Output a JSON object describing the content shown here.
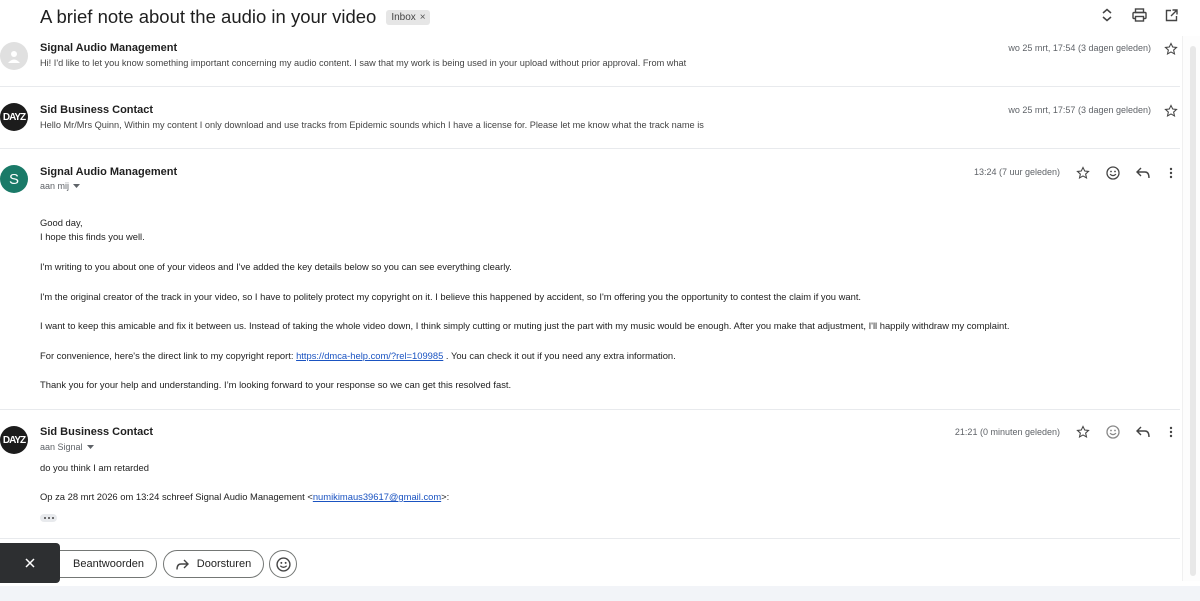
{
  "thread": {
    "subject": "A brief note about the audio in your video",
    "label": "Inbox",
    "label_remove": "×"
  },
  "messages": [
    {
      "sender": "Signal Audio Management",
      "snippet": "Hi! I'd like to let you know something important concerning my audio content. I saw that my work is being used in your upload without prior approval. From what",
      "date": "wo 25 mrt, 17:54 (3 dagen geleden)"
    },
    {
      "sender": "Sid Business Contact",
      "avatar_text": "DAYZ",
      "snippet": "Hello Mr/Mrs Quinn, Within my content I only download and use tracks from Epidemic sounds which I have a license for. Please let me know what the track name is",
      "date": "wo 25 mrt, 17:57 (3 dagen geleden)"
    },
    {
      "sender": "Signal Audio Management",
      "avatar_letter": "S",
      "to": "aan mij",
      "date": "13:24 (7 uur geleden)",
      "body": {
        "greeting": "Good day,",
        "hope": "I hope this finds you well.",
        "p1": "I'm writing to you about one of your videos and I've added the key details below so you can see everything clearly.",
        "p2": "I'm the original creator of the track in your video, so I have to politely protect my copyright on it. I believe this happened by accident, so I'm offering you the opportunity to contest the claim if you want.",
        "p3": "I want to keep this amicable and fix it between us. Instead of taking the whole video down, I think simply cutting or muting just the part with my music would be enough. After you make that adjustment, I'll happily withdraw my complaint.",
        "p4_before": "For convenience, here's the direct link to my copyright report: ",
        "p4_link": "https://dmca-help.com/?rel=109985",
        "p4_after": " . You can check it out if you need any extra information.",
        "p5": "Thank you for your help and understanding. I’m looking forward to your response so we can get this resolved fast."
      }
    },
    {
      "sender": "Sid Business Contact",
      "avatar_text": "DAYZ",
      "to": "aan Signal",
      "date": "21:21 (0 minuten geleden)",
      "body": {
        "line": "do you think I am retarded",
        "quote_before": "Op za 28 mrt 2026 om 13:24 schreef Signal Audio Management <",
        "quote_email": "numikimaus39617@gmail.com",
        "quote_after": ">:"
      }
    }
  ],
  "actions": {
    "reply": "Beantwoorden",
    "forward": "Doorsturen"
  },
  "colors": {
    "link": "#1a53c1",
    "avatar_green": "#1a7a68",
    "toast": "#2d2f31"
  }
}
